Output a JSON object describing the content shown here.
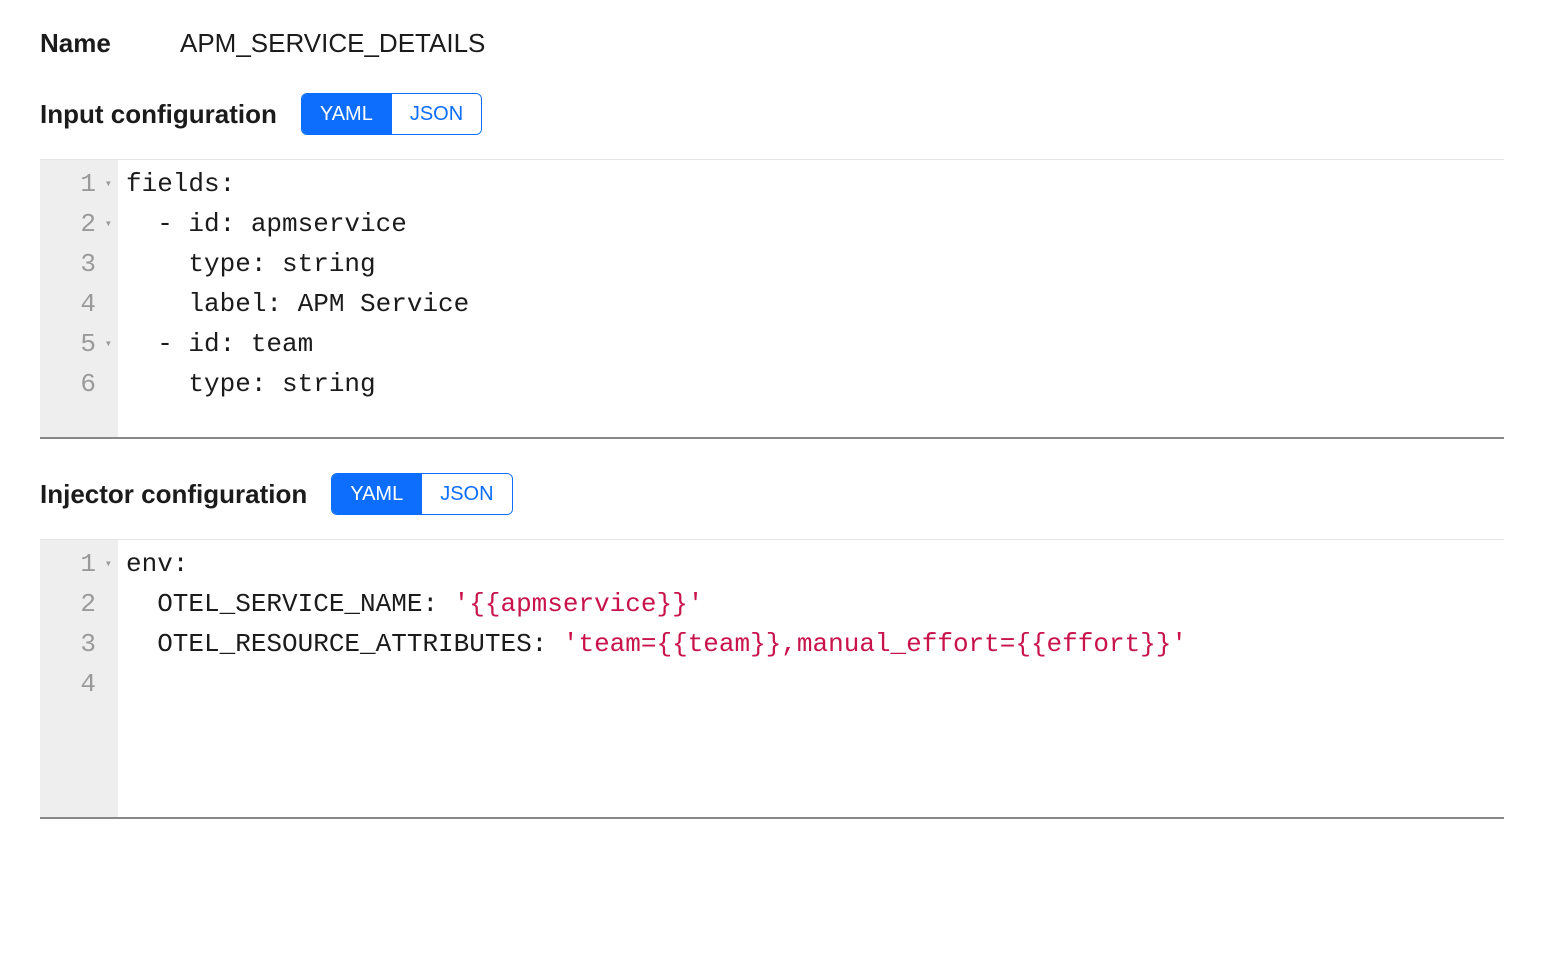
{
  "nameField": {
    "label": "Name",
    "value": "APM_SERVICE_DETAILS"
  },
  "inputConfig": {
    "label": "Input configuration",
    "toggle": {
      "yaml": "YAML",
      "json": "JSON",
      "active": "yaml"
    },
    "lines": [
      {
        "n": "1",
        "fold": true,
        "text": "fields:"
      },
      {
        "n": "2",
        "fold": true,
        "text": "  - id: apmservice"
      },
      {
        "n": "3",
        "fold": false,
        "text": "    type: string"
      },
      {
        "n": "4",
        "fold": false,
        "text": "    label: APM Service"
      },
      {
        "n": "5",
        "fold": true,
        "text": "  - id: team"
      },
      {
        "n": "6",
        "fold": false,
        "text": "    type: string"
      }
    ]
  },
  "injectorConfig": {
    "label": "Injector configuration",
    "toggle": {
      "yaml": "YAML",
      "json": "JSON",
      "active": "yaml"
    },
    "lines": [
      {
        "n": "1",
        "fold": true,
        "segments": [
          {
            "t": "env:",
            "cls": ""
          }
        ]
      },
      {
        "n": "2",
        "fold": false,
        "segments": [
          {
            "t": "  OTEL_SERVICE_NAME: ",
            "cls": ""
          },
          {
            "t": "'{{apmservice}}'",
            "cls": "tok-str"
          }
        ]
      },
      {
        "n": "3",
        "fold": false,
        "segments": [
          {
            "t": "  OTEL_RESOURCE_ATTRIBUTES: ",
            "cls": ""
          },
          {
            "t": "'team={{team}},manual_effort={{effort}}'",
            "cls": "tok-str"
          }
        ]
      },
      {
        "n": "4",
        "fold": false,
        "segments": [
          {
            "t": "",
            "cls": ""
          }
        ]
      }
    ]
  }
}
